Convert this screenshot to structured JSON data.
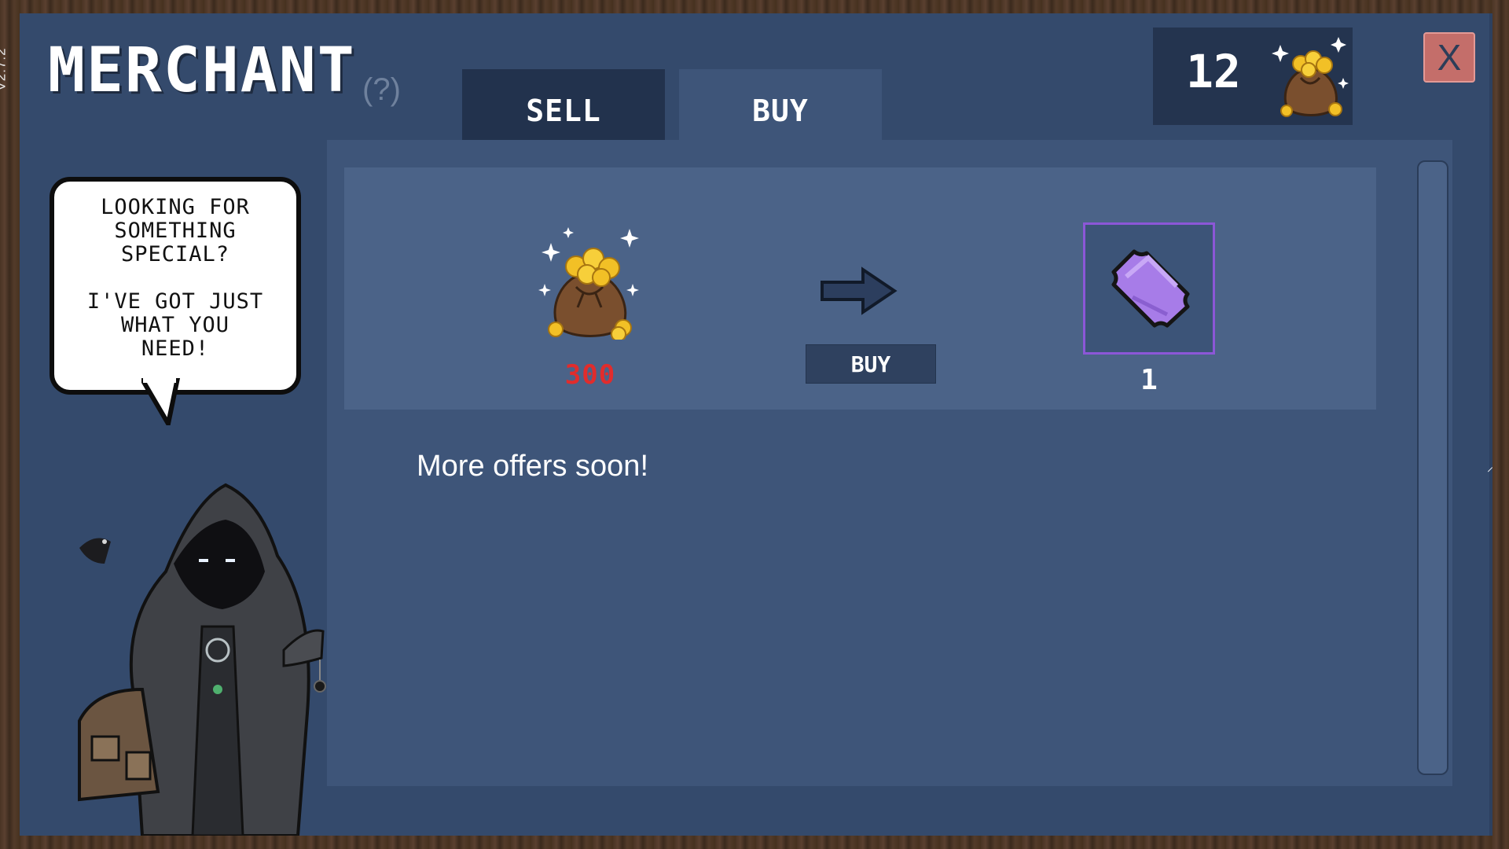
{
  "app": {
    "version": "V2.7.2"
  },
  "header": {
    "title": "MERCHANT",
    "help_label": "(?)",
    "close_label": "X"
  },
  "tabs": [
    {
      "label": "SELL",
      "active": false
    },
    {
      "label": "BUY",
      "active": true
    }
  ],
  "currency": {
    "count": "12",
    "icon": "gold-sack-icon"
  },
  "merchant": {
    "speech": "LOOKING FOR\nSOMETHING\nSPECIAL?\n\nI'VE GOT JUST\nWHAT YOU\nNEED!",
    "icon": "hooded-merchant-portrait"
  },
  "offers": [
    {
      "cost": "300",
      "cost_icon": "gold-sack-icon",
      "buy_label": "BUY",
      "reward_icon": "purple-ticket-icon",
      "reward_quantity": "1"
    }
  ],
  "footer_note": "More offers soon!",
  "colors": {
    "panel": "#344a6c",
    "content": "#3e5579",
    "offer_row": "#4b6388",
    "insufficient_cost": "#e12c2c",
    "reward_border": "#8c57d7",
    "close_button": "#c46e6a"
  }
}
